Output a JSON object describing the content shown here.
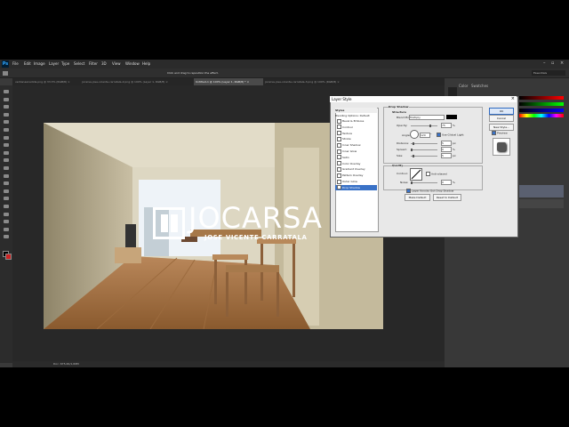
{
  "app": {
    "logo": "Ps"
  },
  "menu": [
    "File",
    "Edit",
    "Image",
    "Layer",
    "Type",
    "Select",
    "Filter",
    "3D",
    "View",
    "Window",
    "Help"
  ],
  "options_bar": {
    "hint": "Click and drag to reposition the effect."
  },
  "tabs": [
    {
      "label": "ventanaanadida.png @ 33.3% (RGB/8) ×",
      "active": false
    },
    {
      "label": "jocarsa-jose-vicente-carratala-2.png @ 100% (Layer 1, RGB/8) ×",
      "active": false
    },
    {
      "label": "Untitled-1 @ 100% (Layer 1, RGB/8) * ×",
      "active": true
    },
    {
      "label": "jocarsa-jose-vicente-carratala-3.png @ 100% (RGB/8) ×",
      "active": false
    }
  ],
  "status_bar": {
    "doc": "Doc: 675,0K/1,69M"
  },
  "right_panel": {
    "tab1": "Color",
    "tab2": "Swatches",
    "workspace": "Essentials"
  },
  "watermark": {
    "brand": "JOCARSA",
    "person": "JOSE VICENTE CARRATALA"
  },
  "dialog": {
    "title": "Layer Style",
    "styles_header": "Styles",
    "blending_header": "Blending Options: Default",
    "effects": [
      "Bevel & Emboss",
      "Contour",
      "Texture",
      "Stroke",
      "Inner Shadow",
      "Inner Glow",
      "Satin",
      "Color Overlay",
      "Gradient Overlay",
      "Pattern Overlay",
      "Outer Glow",
      "Drop Shadow"
    ],
    "selected_effect": "Drop Shadow",
    "section_title": "Drop Shadow",
    "structure_title": "Structure",
    "blend_mode_label": "Blend Mode:",
    "blend_mode": "Multiply",
    "opacity_label": "Opacity:",
    "opacity": "75",
    "angle_label": "Angle:",
    "angle": "120",
    "global_light": "Use Global Light",
    "distance_label": "Distance:",
    "distance": "5",
    "spread_label": "Spread:",
    "spread": "0",
    "size_label": "Size:",
    "size": "5",
    "quality_title": "Quality",
    "contour_label": "Contour:",
    "anti_aliased": "Anti-aliased",
    "noise_label": "Noise:",
    "noise": "0",
    "knockout": "Layer Knocks Out Drop Shadow",
    "make_default": "Make Default",
    "reset_default": "Reset to Default",
    "ok": "OK",
    "cancel": "Cancel",
    "new_style": "New Style...",
    "preview": "Preview",
    "unit_pct": "%",
    "unit_px": "px",
    "unit_deg": "°"
  }
}
